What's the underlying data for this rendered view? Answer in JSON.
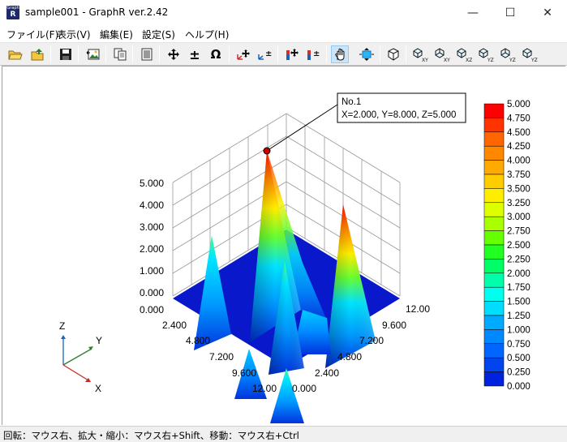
{
  "window": {
    "title": "sample001 - GraphR ver.2.42",
    "app_icon_top": "Graph",
    "app_icon_letter": "R",
    "minimize": "—",
    "maximize": "☐",
    "close": "✕"
  },
  "menu": [
    "ファイル(F)",
    "表示(V)",
    "編集(E)",
    "設定(S)",
    "ヘルプ(H)"
  ],
  "toolbar": {
    "tools": [
      "open-folder",
      "save-folder",
      "save-disk",
      "export-image",
      "copy",
      "paste-document",
      "move",
      "plus-minus",
      "omega",
      "axis-move",
      "axis-plus-minus",
      "color-move",
      "color-plus-minus",
      "hand",
      "fit-vertical",
      "cube",
      "view-xy",
      "view-xy-2",
      "view-xz",
      "view-yz",
      "view-yz-2",
      "view-yz-3"
    ],
    "plus_minus": "±",
    "omega": "Ω",
    "view_labels": [
      "XY",
      "XY",
      "XZ",
      "YZ",
      "YZ",
      "YZ"
    ]
  },
  "chart": {
    "z_ticks": [
      "5.000",
      "4.000",
      "3.000",
      "2.000",
      "1.000",
      "0.000"
    ],
    "x_ticks": [
      "0.000",
      "2.400",
      "4.800",
      "7.200",
      "9.600",
      "12.00"
    ],
    "y_ticks": [
      "12.00",
      "9.600",
      "7.200",
      "4.800",
      "2.400",
      "0.000"
    ],
    "tooltip_line1": "No.1",
    "tooltip_line2": "X=2.000, Y=8.000, Z=5.000",
    "axis_labels": {
      "z": "Z",
      "y": "Y",
      "x": "X"
    },
    "legend": [
      "5.000",
      "4.750",
      "4.500",
      "4.250",
      "4.000",
      "3.750",
      "3.500",
      "3.250",
      "3.000",
      "2.750",
      "2.500",
      "2.250",
      "2.000",
      "1.750",
      "1.500",
      "1.250",
      "1.000",
      "0.750",
      "0.500",
      "0.250",
      "0.000"
    ],
    "legend_colors": [
      "#ff0000",
      "#ff3300",
      "#ff6600",
      "#ff8800",
      "#ffaa00",
      "#ffcc00",
      "#ffee00",
      "#ddff00",
      "#aaff00",
      "#66ff00",
      "#22ff22",
      "#00ff66",
      "#00ffaa",
      "#00ffee",
      "#00ddff",
      "#00aaff",
      "#0088ff",
      "#0066ff",
      "#0044ee",
      "#0022dd",
      "#0000cc"
    ]
  },
  "chart_data": {
    "type": "surface3d",
    "z_range": [
      0,
      5
    ],
    "x_range": [
      0,
      12
    ],
    "y_range": [
      0,
      12
    ],
    "marked_point": {
      "label": "No.1",
      "x": 2.0,
      "y": 8.0,
      "z": 5.0
    }
  },
  "status": "回転：マウス右、拡大・縮小：マウス右+Shift、移動：マウス右+Ctrl"
}
